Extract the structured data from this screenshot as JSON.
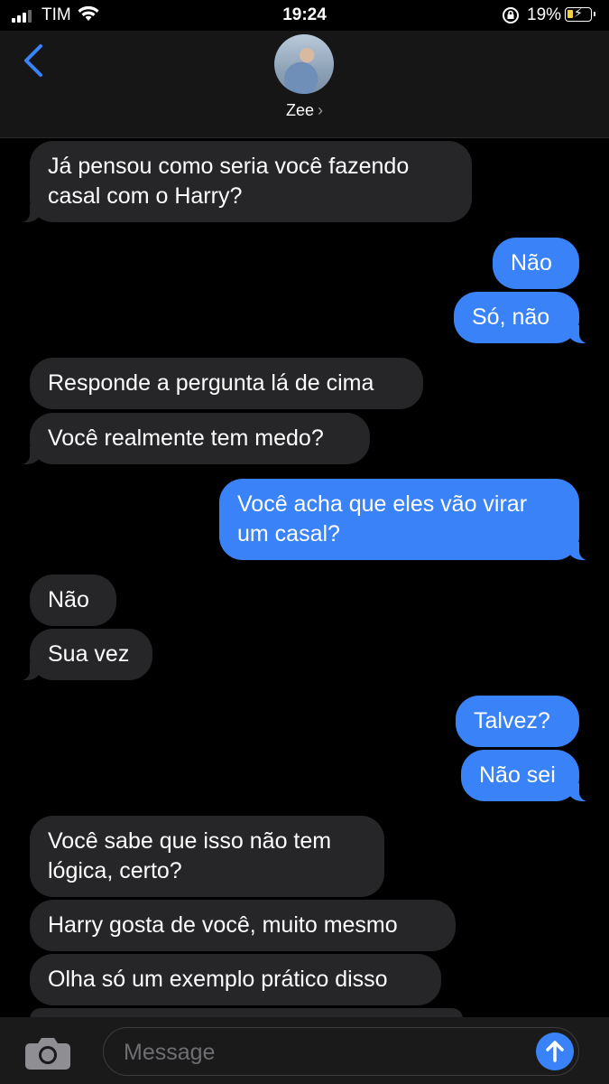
{
  "status": {
    "carrier": "TIM",
    "time": "19:24",
    "battery": "19%"
  },
  "header": {
    "contact_name": "Zee",
    "chevron": "›"
  },
  "messages": [
    {
      "from": "them",
      "lines": [
        "Já pensou como seria você fazendo",
        "casal com o Harry?"
      ]
    },
    {
      "from": "me",
      "text": "Não"
    },
    {
      "from": "me",
      "text": "Só, não"
    },
    {
      "from": "them",
      "text": "Responde a pergunta lá de cima"
    },
    {
      "from": "them",
      "text": "Você realmente tem medo?"
    },
    {
      "from": "me",
      "lines": [
        "Você acha que eles vão virar",
        "um casal?"
      ]
    },
    {
      "from": "them",
      "text": "Não"
    },
    {
      "from": "them",
      "text": "Sua vez"
    },
    {
      "from": "me",
      "text": "Talvez?"
    },
    {
      "from": "me",
      "text": "Não sei"
    },
    {
      "from": "them",
      "lines": [
        "Você sabe que isso não tem",
        "lógica, certo?"
      ]
    },
    {
      "from": "them",
      "text": "Harry gosta de você, muito mesmo"
    },
    {
      "from": "them",
      "text": "Olha só um exemplo prático disso"
    }
  ],
  "composer": {
    "placeholder": "Message"
  },
  "colors": {
    "sent": "#3a82f7",
    "received": "#262628",
    "accent": "#3a82f7"
  },
  "icons": {
    "back": "chevron-left-icon",
    "camera": "camera-icon",
    "send": "arrow-up-icon"
  }
}
